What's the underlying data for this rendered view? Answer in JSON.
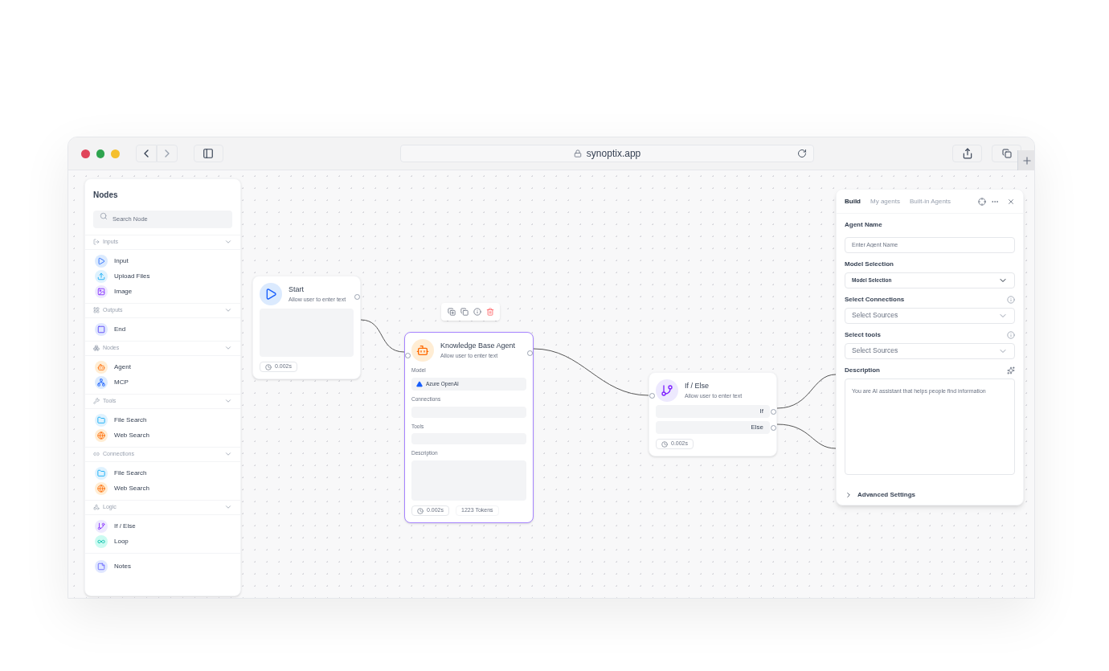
{
  "browser": {
    "url": "synoptix.app"
  },
  "sidebar": {
    "title": "Nodes",
    "search": {
      "placeholder": "Search Node"
    },
    "sections": [
      {
        "label": "Inputs",
        "kind": "inputs",
        "expanded": true,
        "items": [
          {
            "label": "Input",
            "kind": "play"
          },
          {
            "label": "Upload Files",
            "kind": "upload"
          },
          {
            "label": "Image",
            "kind": "image"
          }
        ]
      },
      {
        "label": "Outputs",
        "kind": "outputs",
        "expanded": true,
        "items": [
          {
            "label": "End",
            "kind": "end"
          }
        ]
      },
      {
        "label": "Nodes",
        "kind": "nodes",
        "expanded": true,
        "items": [
          {
            "label": "Agent",
            "kind": "agent"
          },
          {
            "label": "MCP",
            "kind": "mcp"
          }
        ]
      },
      {
        "label": "Tools",
        "kind": "tools",
        "expanded": true,
        "items": [
          {
            "label": "File Search",
            "kind": "file"
          },
          {
            "label": "Web Search",
            "kind": "web"
          }
        ]
      },
      {
        "label": "Connections",
        "kind": "connections",
        "expanded": true,
        "items": [
          {
            "label": "File Search",
            "kind": "file"
          },
          {
            "label": "Web Search",
            "kind": "web"
          }
        ]
      },
      {
        "label": "Logic",
        "kind": "logic",
        "expanded": true,
        "items": [
          {
            "label": "If / Else",
            "kind": "branch"
          },
          {
            "label": "Loop",
            "kind": "loop"
          }
        ]
      }
    ],
    "footer_items": [
      {
        "label": "Notes",
        "kind": "notes"
      }
    ]
  },
  "canvas": {
    "nodes": [
      {
        "kind": "start",
        "title": "Start",
        "subtitle": "Allow user to enter text",
        "selected": false,
        "time": "0.002s"
      },
      {
        "kind": "agent",
        "title": "Knowledge Base Agent",
        "subtitle": "Allow user to enter text",
        "selected": true,
        "fields": [
          {
            "label": "Model",
            "value": "Azure OpenAI"
          },
          {
            "label": "Connections"
          },
          {
            "label": "Tools"
          },
          {
            "label": "Description"
          }
        ],
        "time": "0.002s",
        "tokens": "1223 Tokens"
      },
      {
        "kind": "branch",
        "title": "If / Else",
        "subtitle": "Allow user to enter text",
        "selected": false,
        "outputs": [
          "If",
          "Else"
        ],
        "time": "0.002s"
      }
    ]
  },
  "panel": {
    "tabs": [
      {
        "label": "Build",
        "selected": true
      },
      {
        "label": "My agents",
        "selected": false
      },
      {
        "label": "Built-in Agents",
        "selected": false
      }
    ],
    "fields": [
      {
        "kind": "text",
        "label": "Agent Name",
        "placeholder": "Enter Agent Name"
      },
      {
        "kind": "select",
        "label": "Model Selection",
        "value": "Model Selection",
        "info": false
      },
      {
        "kind": "select",
        "label": "Select Connections",
        "placeholder": "Select Sources",
        "info": true
      },
      {
        "kind": "select",
        "label": "Select tools",
        "placeholder": "Select Sources",
        "info": true
      },
      {
        "kind": "textarea",
        "label": "Description",
        "placeholder": "You are AI assistant that helps people find information"
      }
    ],
    "advanced": {
      "label": "Advanced Settings",
      "expanded": false
    }
  }
}
